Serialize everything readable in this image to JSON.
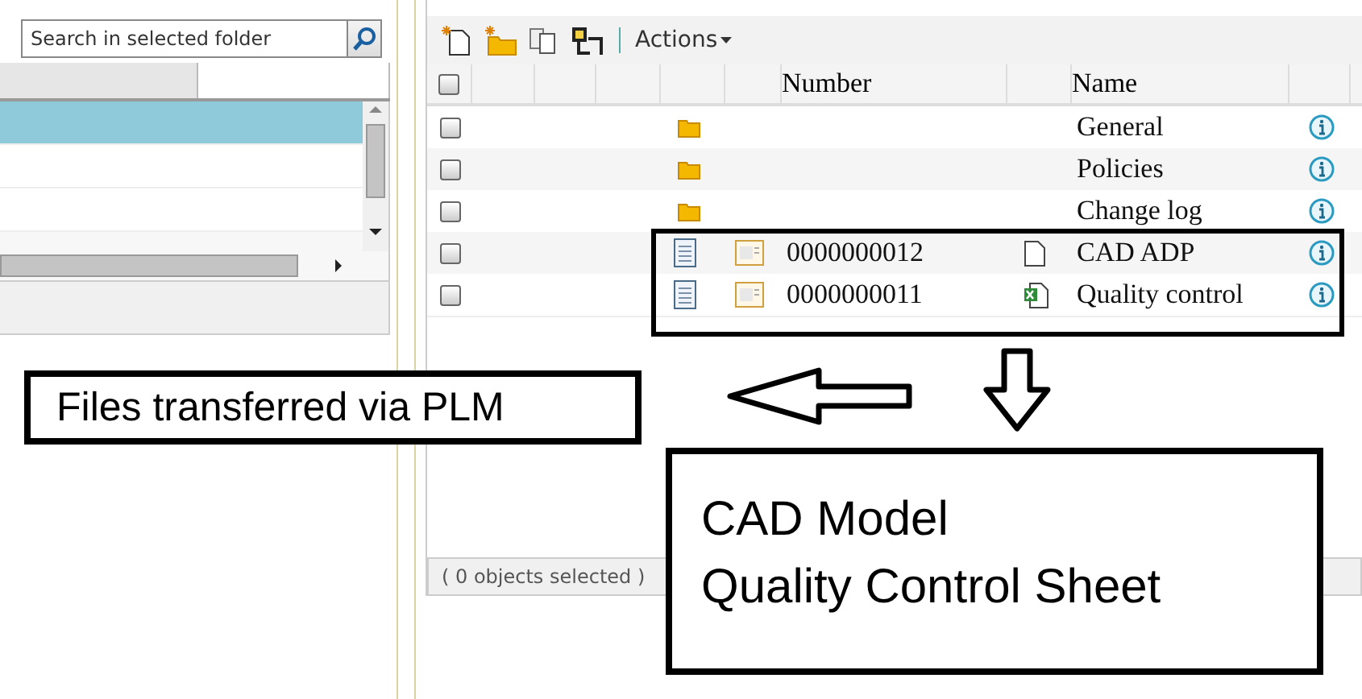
{
  "search": {
    "placeholder": "Search in selected folder"
  },
  "folder_list": {
    "rows": [
      {
        "selected": true
      },
      {
        "selected": false
      },
      {
        "selected": false
      }
    ]
  },
  "toolbar": {
    "actions_label": "Actions"
  },
  "table": {
    "header_checked": false,
    "columns": [
      "Number",
      "Name"
    ],
    "rows": [
      {
        "kind": "folder",
        "checked": false,
        "name": "General"
      },
      {
        "kind": "folder",
        "checked": false,
        "name": "Policies"
      },
      {
        "kind": "folder",
        "checked": false,
        "name": "Change log"
      },
      {
        "kind": "document",
        "checked": false,
        "number": "0000000012",
        "file": {
          "kind": "blank"
        },
        "name": "CAD ADP"
      },
      {
        "kind": "document",
        "checked": false,
        "number": "0000000011",
        "file": {
          "kind": "spreadsheet"
        },
        "name": "Quality control"
      }
    ]
  },
  "status_bar": "( 0 objects selected )",
  "annotations": {
    "label": "Files transferred via PLM",
    "callout": [
      "CAD Model",
      "Quality Control Sheet"
    ]
  }
}
